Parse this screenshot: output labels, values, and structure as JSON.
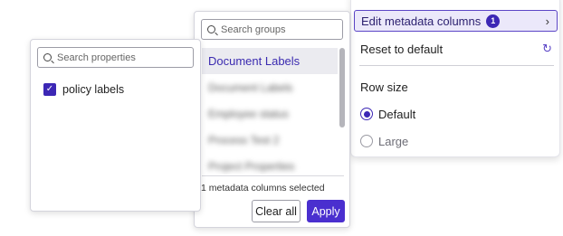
{
  "settings_menu": {
    "edit_columns_label": "Edit metadata columns",
    "edit_columns_badge": "1",
    "chevron_glyph": "›",
    "reset_label": "Reset to default",
    "reset_icon_glyph": "↻",
    "row_size_title": "Row size",
    "row_size_options": [
      {
        "label": "Default",
        "checked": true
      },
      {
        "label": "Large",
        "checked": false
      }
    ]
  },
  "groups_popover": {
    "search_placeholder": "Search groups",
    "items": [
      {
        "label": "Document Labels",
        "selected": true,
        "blurred": false
      },
      {
        "label": "Document Labels",
        "selected": false,
        "blurred": true
      },
      {
        "label": "Employee status",
        "selected": false,
        "blurred": true
      },
      {
        "label": "Process Test 2",
        "selected": false,
        "blurred": true
      },
      {
        "label": "Project Properties",
        "selected": false,
        "blurred": true
      }
    ],
    "selected_count_text": "1 metadata columns selected",
    "clear_label": "Clear all",
    "apply_label": "Apply"
  },
  "properties_popover": {
    "search_placeholder": "Search properties",
    "items": [
      {
        "label": "policy labels",
        "checked": true
      }
    ],
    "check_glyph": "✓"
  },
  "colors": {
    "accent": "#4a2fcf",
    "badge": "#3c27b5",
    "selected_bg": "#ebebf0"
  }
}
